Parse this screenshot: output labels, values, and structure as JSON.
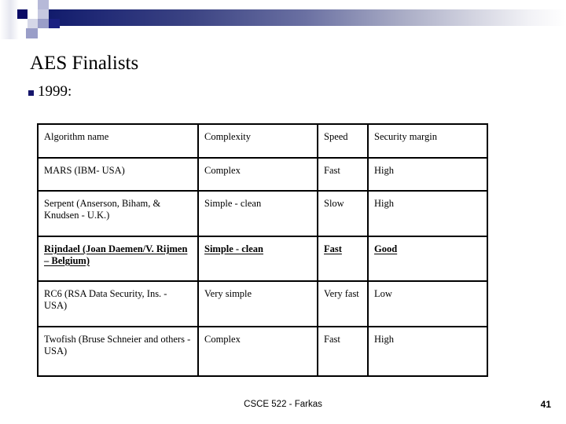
{
  "slide": {
    "title": "AES Finalists",
    "bullet": {
      "icon": "square-bullet-icon",
      "text": "1999:"
    }
  },
  "header_decoration": {
    "icon": "gradient-bar-decoration",
    "gradient_start_color": "#101a6b",
    "gradient_end_color": "#ffffff",
    "accent_square_color": "#0a0a66"
  },
  "table": {
    "headers": [
      "Algorithm name",
      "Complexity",
      "Speed",
      "Security margin"
    ],
    "rows": [
      {
        "highlighted": false,
        "cells": [
          "MARS (IBM- USA)",
          "Complex",
          "Fast",
          "High"
        ]
      },
      {
        "highlighted": false,
        "cells": [
          "Serpent (Anserson, Biham, & Knudsen - U.K.)",
          "Simple - clean",
          "Slow",
          "High"
        ]
      },
      {
        "highlighted": true,
        "cells": [
          "Rijndael (Joan Daemen/V. Rijmen – Belgium)",
          "Simple - clean",
          "Fast",
          "Good"
        ]
      },
      {
        "highlighted": false,
        "cells": [
          "RC6 (RSA Data Security, Ins. - USA)",
          "Very simple",
          "Very fast",
          "Low"
        ]
      },
      {
        "highlighted": false,
        "cells": [
          "Twofish (Bruse Schneier and others - USA)",
          "Complex",
          "Fast",
          "High"
        ]
      }
    ],
    "highlight_color": "#14585c"
  },
  "footer": {
    "text": "CSCE 522 - Farkas",
    "page_number": "41"
  }
}
